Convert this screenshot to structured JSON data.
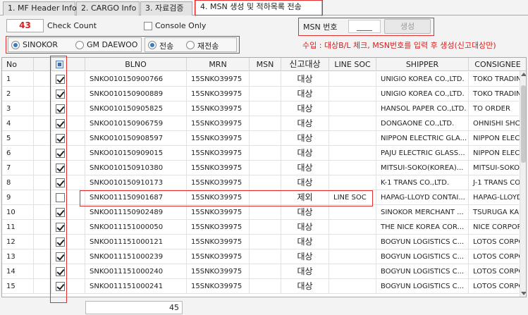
{
  "tabs": [
    {
      "label": "1. MF Header Info"
    },
    {
      "label": "2. CARGO Info"
    },
    {
      "label": "3. 자료검증"
    },
    {
      "label": "4. MSN 생성 및 적하목록 전송",
      "active": true
    }
  ],
  "controls": {
    "check_count_value": "43",
    "check_count_label": "Check Count",
    "console_only_label": "Console Only",
    "console_only_checked": false,
    "msn_label": "MSN 번호",
    "msn_value": "____",
    "generate_label": "생성",
    "carrier_options": [
      "SINOKOR",
      "GM DAEWOO"
    ],
    "carrier_selected": "SINOKOR",
    "send_options": [
      "전송",
      "재전송"
    ],
    "send_selected": "전송",
    "notice": "수입 : 대상B/L 체크, MSN번호를 입력 후 생성(신고대상만)"
  },
  "grid": {
    "columns": [
      "No",
      "",
      "",
      "BLNO",
      "MRN",
      "MSN",
      "신고대상",
      "LINE SOC",
      "SHIPPER",
      "CONSIGNEE"
    ],
    "rows": [
      {
        "no": "1",
        "checked": true,
        "blno": "SNKO010150900766",
        "mrn": "15SNKO39975",
        "msn": "",
        "target": "대상",
        "line_soc": "",
        "shipper": "UNIGIO KOREA CO.,LTD.",
        "consignee": "TOKO TRADIN"
      },
      {
        "no": "2",
        "checked": true,
        "blno": "SNKO010150900889",
        "mrn": "15SNKO39975",
        "msn": "",
        "target": "대상",
        "line_soc": "",
        "shipper": "UNIGIO KOREA CO.,LTD.",
        "consignee": "TOKO TRADIN"
      },
      {
        "no": "3",
        "checked": true,
        "blno": "SNKO010150905825",
        "mrn": "15SNKO39975",
        "msn": "",
        "target": "대상",
        "line_soc": "",
        "shipper": "HANSOL PAPER CO.,LTD.",
        "consignee": "TO ORDER"
      },
      {
        "no": "4",
        "checked": true,
        "blno": "SNKO010150906759",
        "mrn": "15SNKO39975",
        "msn": "",
        "target": "대상",
        "line_soc": "",
        "shipper": "DONGAONE CO.,LTD.",
        "consignee": "OHNISHI SHC"
      },
      {
        "no": "5",
        "checked": true,
        "blno": "SNKO010150908597",
        "mrn": "15SNKO39975",
        "msn": "",
        "target": "대상",
        "line_soc": "",
        "shipper": "NIPPON ELECTRIC GLA...",
        "consignee": "NIPPON ELEC"
      },
      {
        "no": "6",
        "checked": true,
        "blno": "SNKO010150909015",
        "mrn": "15SNKO39975",
        "msn": "",
        "target": "대상",
        "line_soc": "",
        "shipper": "PAJU ELECTRIC GLASS...",
        "consignee": "NIPPON ELEC"
      },
      {
        "no": "7",
        "checked": true,
        "blno": "SNKO010150910380",
        "mrn": "15SNKO39975",
        "msn": "",
        "target": "대상",
        "line_soc": "",
        "shipper": "MITSUI-SOKO(KOREA)...",
        "consignee": "MITSUI-SOKO"
      },
      {
        "no": "8",
        "checked": true,
        "blno": "SNKO010150910173",
        "mrn": "15SNKO39975",
        "msn": "",
        "target": "대상",
        "line_soc": "",
        "shipper": "K-1 TRANS CO.,LTD.",
        "consignee": "J-1 TRANS CO"
      },
      {
        "no": "9",
        "checked": false,
        "blno": "SNKO011150901687",
        "mrn": "15SNKO39975",
        "msn": "",
        "target": "제외",
        "line_soc": "LINE SOC",
        "shipper": "HAPAG-LLOYD CONTAI...",
        "consignee": "HAPAG-LLOYD"
      },
      {
        "no": "10",
        "checked": true,
        "blno": "SNKO011150902489",
        "mrn": "15SNKO39975",
        "msn": "",
        "target": "대상",
        "line_soc": "",
        "shipper": "SINOKOR MERCHANT ...",
        "consignee": "TSURUGA KAI"
      },
      {
        "no": "11",
        "checked": true,
        "blno": "SNKO011151000050",
        "mrn": "15SNKO39975",
        "msn": "",
        "target": "대상",
        "line_soc": "",
        "shipper": "THE NICE KOREA COR...",
        "consignee": "NICE CORPOR"
      },
      {
        "no": "12",
        "checked": true,
        "blno": "SNKO011151000121",
        "mrn": "15SNKO39975",
        "msn": "",
        "target": "대상",
        "line_soc": "",
        "shipper": "BOGYUN LOGISTICS C...",
        "consignee": "LOTOS CORPO"
      },
      {
        "no": "13",
        "checked": true,
        "blno": "SNKO011151000239",
        "mrn": "15SNKO39975",
        "msn": "",
        "target": "대상",
        "line_soc": "",
        "shipper": "BOGYUN LOGISTICS C...",
        "consignee": "LOTOS CORPO"
      },
      {
        "no": "14",
        "checked": true,
        "blno": "SNKO011151000240",
        "mrn": "15SNKO39975",
        "msn": "",
        "target": "대상",
        "line_soc": "",
        "shipper": "BOGYUN LOGISTICS C...",
        "consignee": "LOTOS CORPO"
      },
      {
        "no": "15",
        "checked": true,
        "blno": "SNKO011151000241",
        "mrn": "15SNKO39975",
        "msn": "",
        "target": "대상",
        "line_soc": "",
        "shipper": "BOGYUN LOGISTICS C...",
        "consignee": "LOTOS CORPO"
      }
    ]
  },
  "footer": {
    "total": "45"
  },
  "colors": {
    "highlight": "#e03030",
    "count": "#d81e1e",
    "radio_on": "#3a78c8"
  }
}
